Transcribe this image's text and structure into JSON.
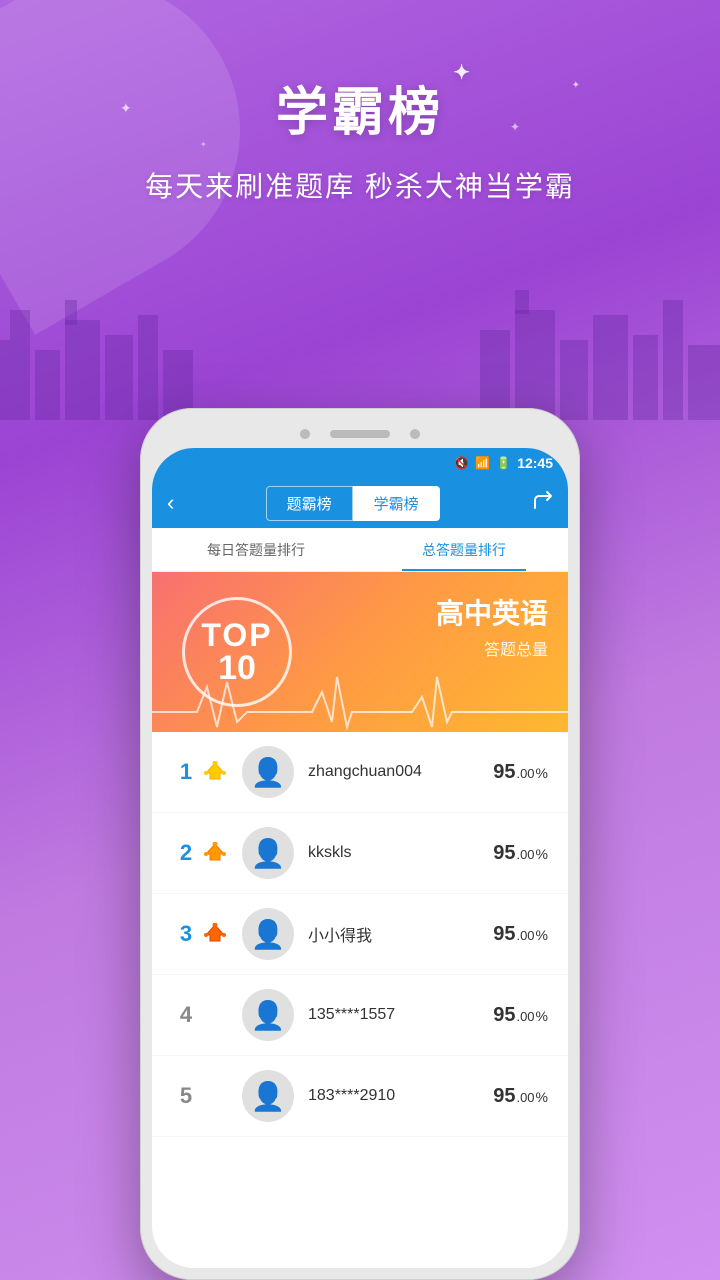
{
  "app": {
    "background_gradient_start": "#b066e0",
    "background_gradient_end": "#d090f0"
  },
  "header": {
    "main_title": "学霸榜",
    "subtitle": "每天来刷准题库 秒杀大神当学霸",
    "sparkle": "✦"
  },
  "status_bar": {
    "time": "12:45",
    "signal_icon": "📶",
    "battery_icon": "🔋",
    "mute_icon": "🔇"
  },
  "nav": {
    "back_icon": "‹",
    "tabs": [
      {
        "label": "题霸榜",
        "active": false
      },
      {
        "label": "学霸榜",
        "active": true
      }
    ],
    "share_icon": "⬆"
  },
  "sub_tabs": [
    {
      "label": "每日答题量排行",
      "active": false
    },
    {
      "label": "总答题量排行",
      "active": true
    }
  ],
  "banner": {
    "top_label": "TOP",
    "top_number": "10",
    "subject": "高中英语",
    "subject_label": "答题总量",
    "gradient_start": "#f87070",
    "gradient_end": "#ffb830"
  },
  "leaderboard": {
    "items": [
      {
        "rank": "1",
        "rank_type": "gold",
        "crown": true,
        "crown_color": "#ffcc00",
        "username": "zhangchuan004",
        "score_main": "95",
        "score_decimal": ".00",
        "score_unit": "%"
      },
      {
        "rank": "2",
        "rank_type": "silver",
        "crown": true,
        "crown_color": "#ff9900",
        "username": "kkskls",
        "score_main": "95",
        "score_decimal": ".00",
        "score_unit": "%"
      },
      {
        "rank": "3",
        "rank_type": "bronze",
        "crown": true,
        "crown_color": "#ff6600",
        "username": "小小得我",
        "score_main": "95",
        "score_decimal": ".00",
        "score_unit": "%"
      },
      {
        "rank": "4",
        "rank_type": "plain",
        "crown": false,
        "username": "135****1557",
        "score_main": "95",
        "score_decimal": ".00",
        "score_unit": "%"
      },
      {
        "rank": "5",
        "rank_type": "plain",
        "crown": false,
        "username": "183****2910",
        "score_main": "95",
        "score_decimal": ".00",
        "score_unit": "%"
      }
    ]
  }
}
